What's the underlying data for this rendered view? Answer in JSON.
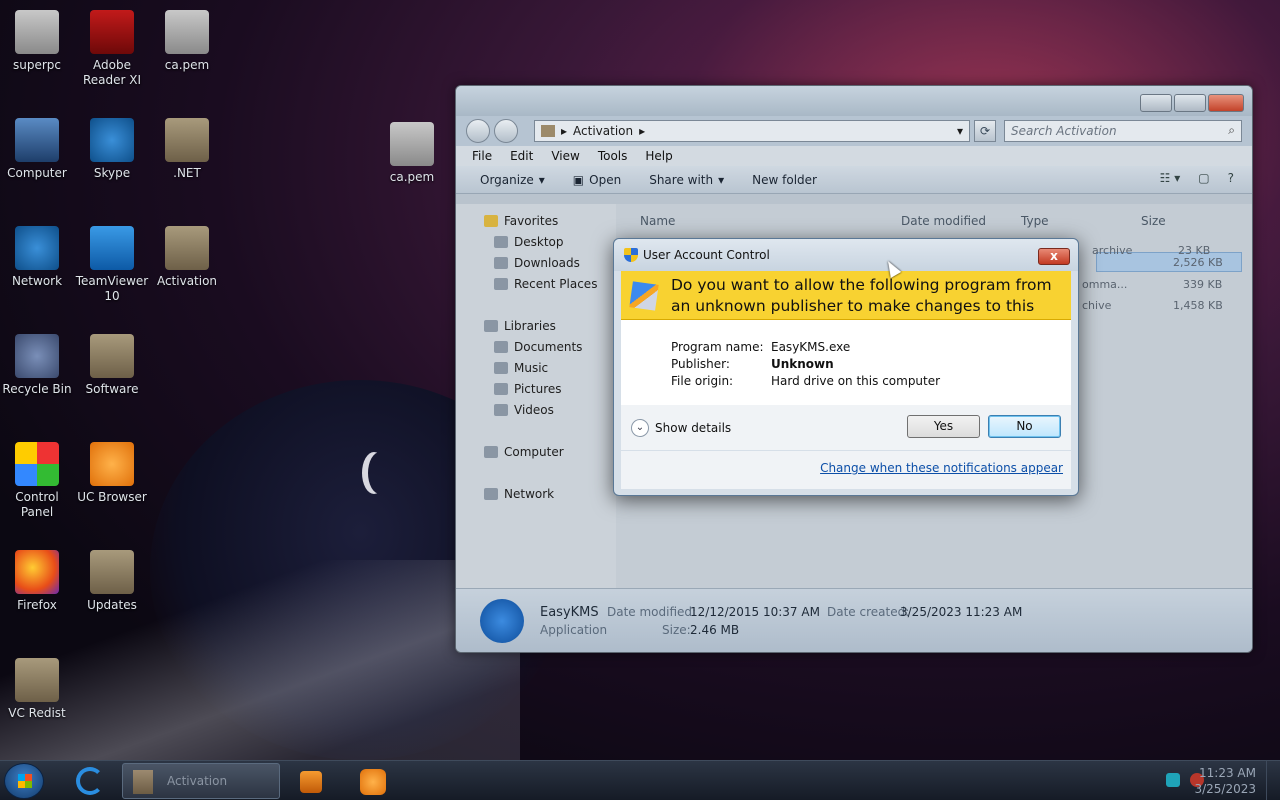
{
  "desktop": {
    "icons": [
      {
        "label": "superpc"
      },
      {
        "label": "Adobe Reader XI"
      },
      {
        "label": "ca.pem"
      },
      {
        "label": "Computer"
      },
      {
        "label": "Skype"
      },
      {
        "label": ".NET"
      },
      {
        "label": "ca.pem"
      },
      {
        "label": "Network"
      },
      {
        "label": "TeamViewer 10"
      },
      {
        "label": "Activation"
      },
      {
        "label": "Recycle Bin"
      },
      {
        "label": "Software"
      },
      {
        "label": "Control Panel"
      },
      {
        "label": "UC Browser"
      },
      {
        "label": "Firefox"
      },
      {
        "label": "Updates"
      },
      {
        "label": "VC Redist"
      }
    ]
  },
  "explorer": {
    "address": {
      "path": "Activation"
    },
    "search": {
      "placeholder": "Search Activation"
    },
    "menu": [
      "File",
      "Edit",
      "View",
      "Tools",
      "Help"
    ],
    "commands": {
      "organize": "Organize",
      "open": "Open",
      "share_with": "Share with",
      "new_folder": "New folder"
    },
    "nav": {
      "favorites": "Favorites",
      "desktop": "Desktop",
      "downloads": "Downloads",
      "recent_places": "Recent Places",
      "libraries": "Libraries",
      "documents": "Documents",
      "music": "Music",
      "pictures": "Pictures",
      "videos": "Videos",
      "computer": "Computer",
      "network": "Network"
    },
    "columns": {
      "name": "Name",
      "date_modified": "Date modified",
      "type": "Type",
      "size": "Size"
    },
    "row_fragments": {
      "r1_type": "archive",
      "r1_size": "23 KB",
      "r2_size": "2,526 KB",
      "r3_type": "omma...",
      "r3_size": "339 KB",
      "r4_type": "chive",
      "r4_size": "1,458 KB"
    },
    "details": {
      "name": "EasyKMS",
      "kind": "Application",
      "date_modified_label": "Date modified:",
      "date_modified": "12/12/2015 10:37 AM",
      "date_created_label": "Date created:",
      "date_created": "3/25/2023 11:23 AM",
      "size_label": "Size:",
      "size": "2.46 MB"
    }
  },
  "uac": {
    "title": "User Account Control",
    "close": "x",
    "question": "Do you want to allow the following program from an unknown publisher to make changes to this computer?",
    "program_name_label": "Program name:",
    "program_name": "EasyKMS.exe",
    "publisher_label": "Publisher:",
    "publisher": "Unknown",
    "file_origin_label": "File origin:",
    "file_origin": "Hard drive on this computer",
    "show_details": "Show details",
    "yes": "Yes",
    "no": "No",
    "change_link": "Change when these notifications appear"
  },
  "taskbar": {
    "active_window": "Activation",
    "clock_time": "11:23 AM",
    "clock_date": "3/25/2023"
  },
  "colors": {
    "uac_banner": "#f8d231",
    "default_button": "#bee6fd",
    "link": "#0c4fa8"
  }
}
